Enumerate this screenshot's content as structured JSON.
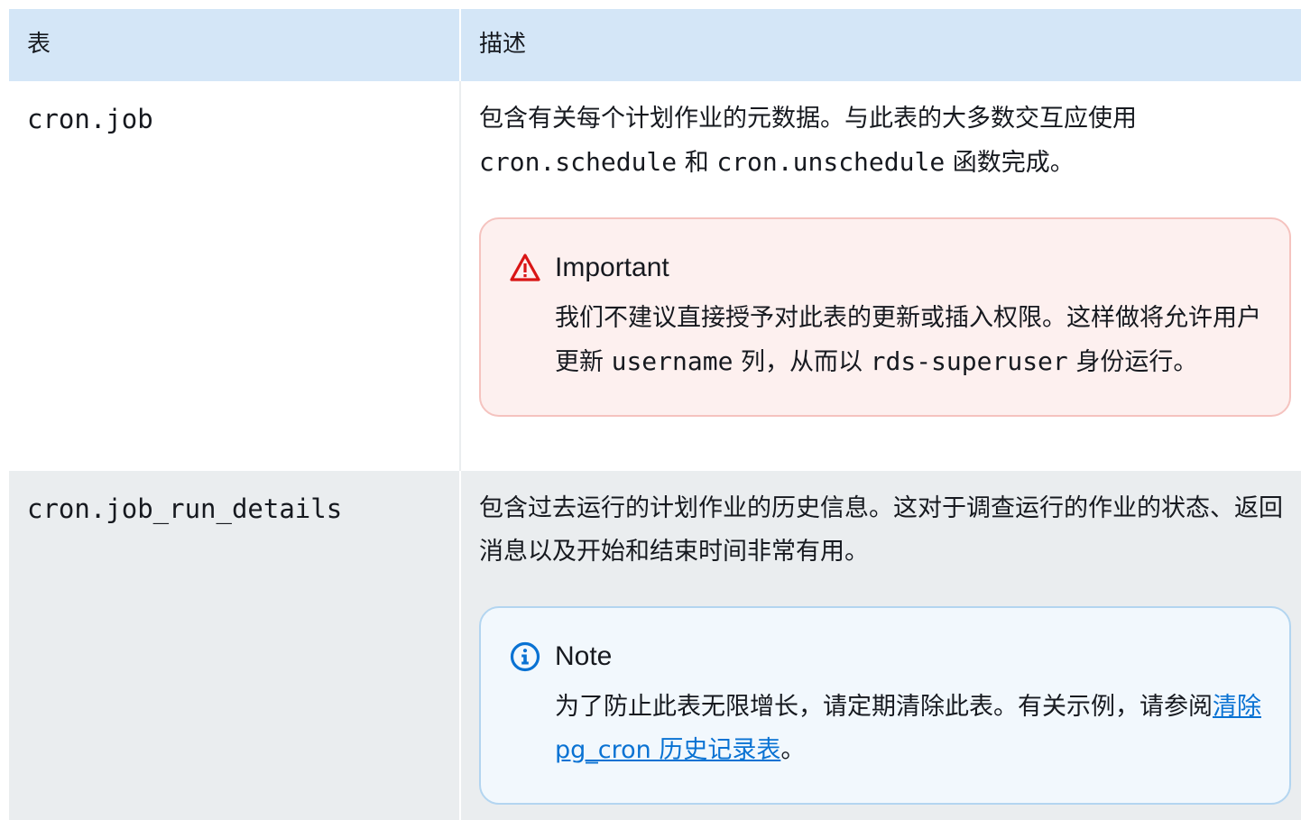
{
  "table": {
    "headers": {
      "table": "表",
      "description": "描述"
    },
    "rows": [
      {
        "name": "cron.job",
        "desc_part1": "包含有关每个计划作业的元数据。与此表的大多数交互应使用",
        "desc_code1": "cron.schedule",
        "desc_part2": " 和 ",
        "desc_code2": "cron.unschedule",
        "desc_part3": " 函数完成。",
        "callout": {
          "type": "important",
          "icon": "warning-icon",
          "title": "Important",
          "body_part1": "我们不建议直接授予对此表的更新或插入权限。这样做将允许用户更新 ",
          "body_code1": "username",
          "body_part2": " 列，从而以 ",
          "body_code2": "rds-superuser",
          "body_part3": " 身份运行。"
        }
      },
      {
        "name": "cron.job_run_details",
        "desc": "包含过去运行的计划作业的历史信息。这对于调查运行的作业的状态、返回消息以及开始和结束时间非常有用。",
        "callout": {
          "type": "note",
          "icon": "info-icon",
          "title": "Note",
          "body_part1": "为了防止此表无限增长，请定期清除此表。有关示例，请参阅",
          "link_text": "清除 pg_cron 历史记录表",
          "body_part2": "。"
        }
      }
    ]
  },
  "colors": {
    "header_bg": "#d4e6f7",
    "row_alt_bg": "#eaedef",
    "important_bg": "#fdf0ef",
    "important_border": "#f5c3bf",
    "important_icon": "#d91515",
    "note_bg": "#f2f8fd",
    "note_border": "#b3d5f0",
    "note_icon": "#0972d3",
    "link": "#0972d3"
  }
}
